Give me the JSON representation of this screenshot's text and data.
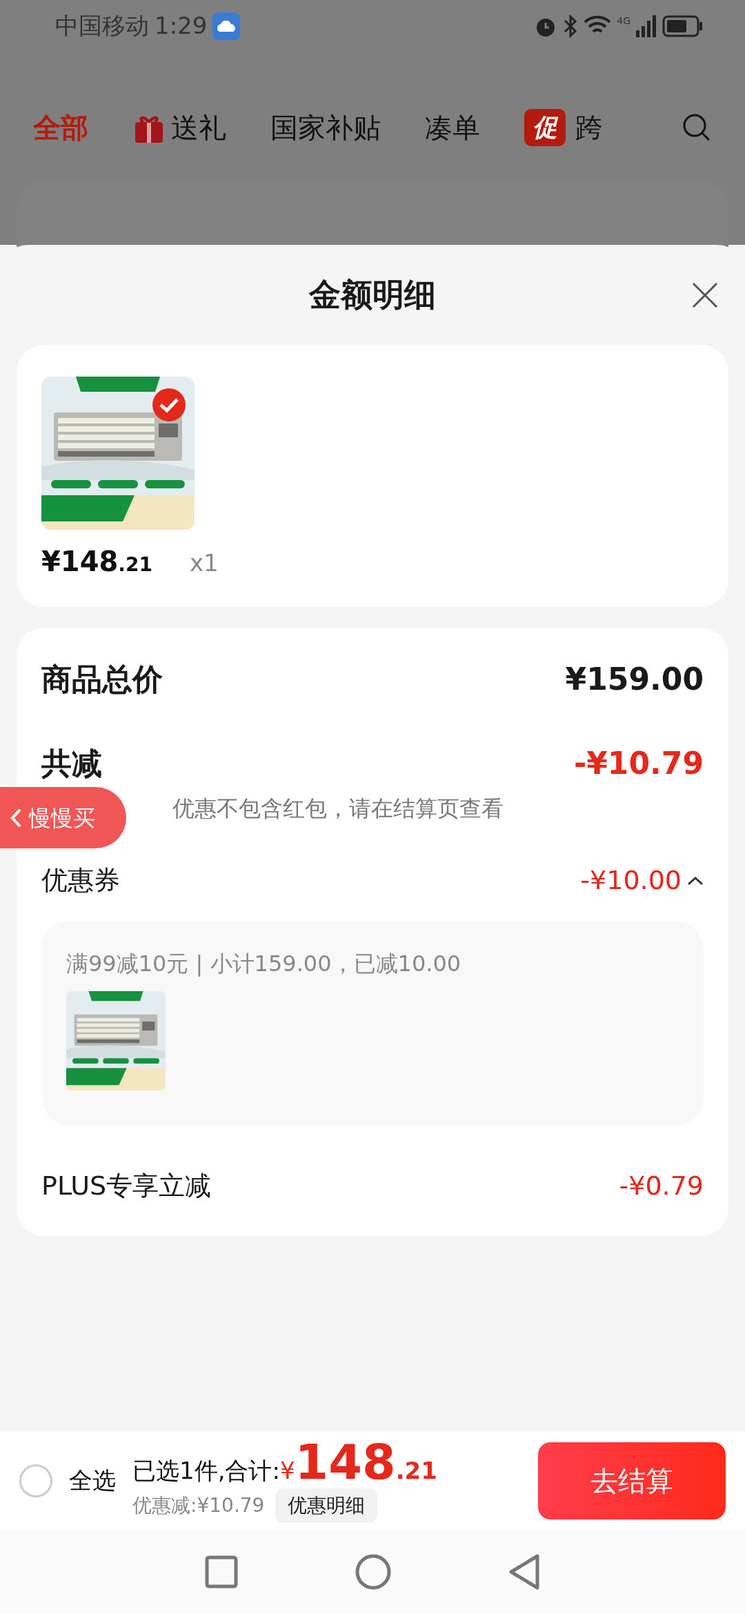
{
  "status_bar": {
    "carrier": "中国移动",
    "time": "1:29",
    "network": "4G"
  },
  "background_tabs": [
    {
      "label": "全部",
      "selected": true,
      "kind": "text"
    },
    {
      "label": "送礼",
      "selected": false,
      "kind": "gift"
    },
    {
      "label": "国家补贴",
      "selected": false,
      "kind": "text"
    },
    {
      "label": "凑单",
      "selected": false,
      "kind": "text"
    },
    {
      "label": "跨",
      "selected": false,
      "kind": "promo",
      "badge": "促"
    }
  ],
  "sheet": {
    "title": "金额明细"
  },
  "product": {
    "selected": true,
    "price_main": "¥148",
    "price_decimal": ".21",
    "quantity": "x1"
  },
  "summary": {
    "rows": [
      {
        "kind": "total",
        "label": "商品总价",
        "amount": "¥159.00"
      },
      {
        "kind": "discount",
        "label": "共减",
        "amount": "-¥10.79",
        "note": "优惠不包含红包，请在结算页查看"
      },
      {
        "kind": "coupon",
        "label": "优惠券",
        "amount": "-¥10.00",
        "expanded": true,
        "detail": "满99减10元 | 小计159.00，已减10.00"
      },
      {
        "kind": "plus",
        "label": "PLUS专享立减",
        "amount": "-¥0.79"
      }
    ]
  },
  "float_button": {
    "label": "慢慢买"
  },
  "bottom_bar": {
    "select_all": {
      "label": "全选",
      "checked": false
    },
    "summary": "已选1件,合计:",
    "currency": "¥",
    "total_main": "148",
    "total_decimal": ".21",
    "discount": "优惠减:¥10.79",
    "detail_button": "优惠明细",
    "checkout": "去结算"
  }
}
